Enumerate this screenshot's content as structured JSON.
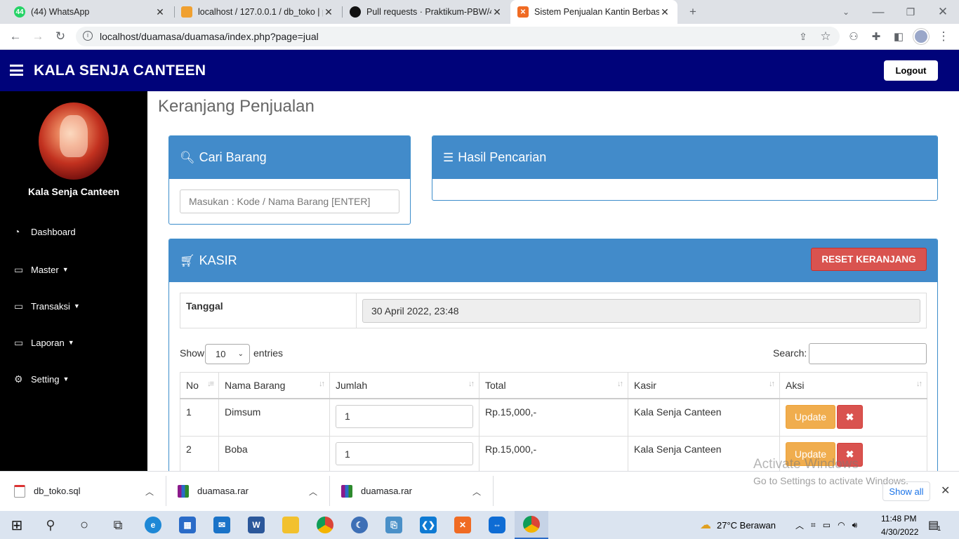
{
  "browser": {
    "tabs": [
      {
        "title": "(44) WhatsApp",
        "badge": "44"
      },
      {
        "title": "localhost / 127.0.0.1 / db_toko | p"
      },
      {
        "title": "Pull requests · Praktikum-PBW/4a"
      },
      {
        "title": "Sistem Penjualan Kantin Berbasis"
      }
    ],
    "url": "localhost/duamasa/duamasa/index.php?page=jual"
  },
  "app": {
    "brand": "KALA SENJA CANTEEN",
    "logout_label": "Logout",
    "sidebar": {
      "user_name": "Kala Senja Canteen",
      "items": [
        {
          "label": "Dashboard",
          "icon": "dashboard-icon"
        },
        {
          "label": "Master",
          "icon": "monitor-icon"
        },
        {
          "label": "Transaksi",
          "icon": "monitor-icon"
        },
        {
          "label": "Laporan",
          "icon": "monitor-icon"
        },
        {
          "label": "Setting",
          "icon": "gear-icon"
        }
      ]
    },
    "page_title": "Keranjang Penjualan",
    "search_panel": {
      "title": "Cari Barang",
      "placeholder": "Masukan : Kode / Nama Barang  [ENTER]"
    },
    "result_panel": {
      "title": "Hasil Pencarian"
    },
    "cashier_panel": {
      "title": "KASIR",
      "reset_label": "RESET KERANJANG",
      "date_label": "Tanggal",
      "date_value": "30 April 2022, 23:48",
      "show_label": "Show",
      "entries_value": "10",
      "entries_label": "entries",
      "search_label": "Search:",
      "columns": [
        "No",
        "Nama Barang",
        "Jumlah",
        "Total",
        "Kasir",
        "Aksi"
      ],
      "rows": [
        {
          "no": "1",
          "nama": "Dimsum",
          "jumlah": "1",
          "total": "Rp.15,000,-",
          "kasir": "Kala Senja Canteen"
        },
        {
          "no": "2",
          "nama": "Boba",
          "jumlah": "1",
          "total": "Rp.15,000,-",
          "kasir": "Kala Senja Canteen"
        }
      ],
      "update_label": "Update",
      "delete_label": "✖"
    }
  },
  "downloads": {
    "items": [
      {
        "name": "db_toko.sql"
      },
      {
        "name": "duamasa.rar"
      },
      {
        "name": "duamasa.rar"
      }
    ],
    "show_all": "Show all"
  },
  "watermark": {
    "line1": "Activate Windows",
    "line2": "Go to Settings to activate Windows."
  },
  "taskbar": {
    "weather": "27°C  Berawan",
    "time": "11:48 PM",
    "date": "4/30/2022",
    "notif_count": "1"
  },
  "colors": {
    "navbar": "#00037a",
    "panel_header": "#428bca",
    "danger": "#d9534f",
    "warning": "#f0ad4e",
    "sidebar": "#000000"
  }
}
